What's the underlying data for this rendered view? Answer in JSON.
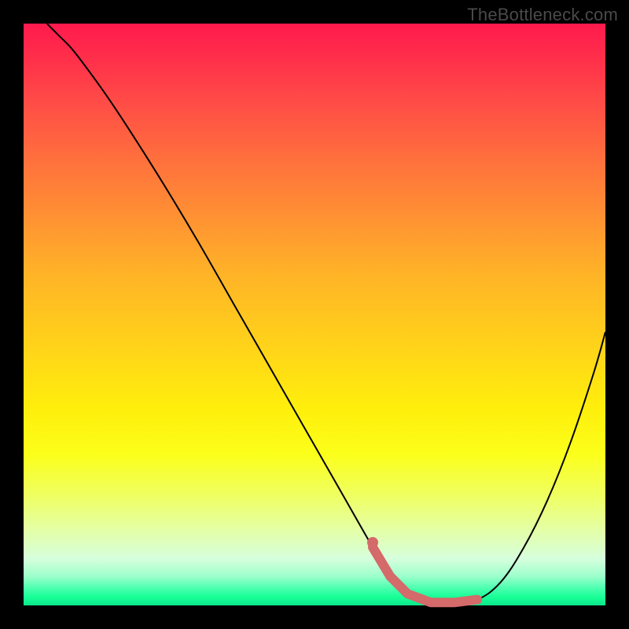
{
  "watermark": "TheBottleneck.com",
  "chart_data": {
    "type": "line",
    "title": "",
    "xlabel": "",
    "ylabel": "",
    "xlim": [
      0,
      100
    ],
    "ylim": [
      0,
      100
    ],
    "series": [
      {
        "name": "bottleneck-curve",
        "x": [
          4,
          6,
          8,
          10,
          14,
          18,
          24,
          30,
          36,
          42,
          48,
          52,
          56,
          60,
          63,
          66,
          70,
          74,
          78,
          82,
          86,
          90,
          94,
          98,
          100
        ],
        "values": [
          100,
          98,
          96,
          93.5,
          88,
          82,
          72.5,
          62.5,
          52,
          41.5,
          31,
          24,
          17,
          10,
          5,
          2,
          0.5,
          0.5,
          1,
          4,
          10,
          18,
          28,
          40,
          47
        ]
      }
    ],
    "highlight": {
      "range_x": [
        59,
        78
      ],
      "description": "optimal-region"
    },
    "background_gradient": {
      "top_color": "#ff1a4d",
      "bottom_color": "#0be88b"
    }
  }
}
